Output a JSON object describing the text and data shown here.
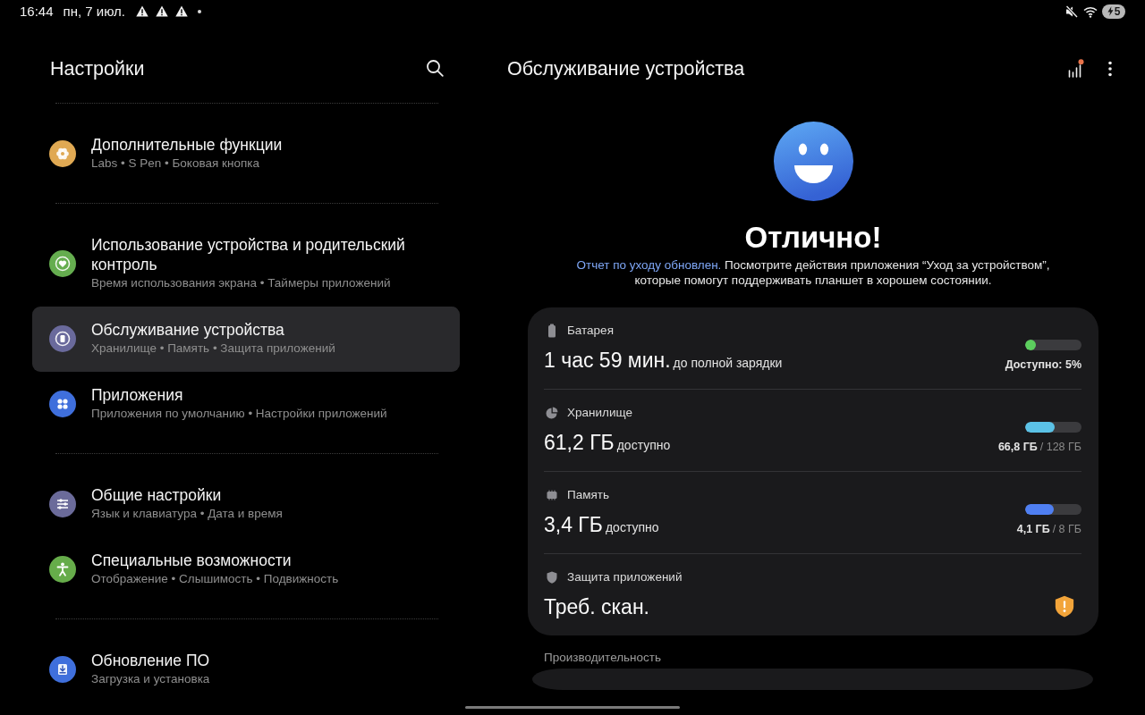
{
  "status_bar": {
    "time": "16:44",
    "date": "пн, 7 июл.",
    "notifications": [
      {
        "kind": "warning"
      },
      {
        "kind": "warning"
      },
      {
        "kind": "warning"
      }
    ],
    "more_notifications": true,
    "muted": true,
    "charging": true,
    "battery": "5"
  },
  "settings": {
    "title": "Настройки",
    "groups": [
      {
        "items": [
          {
            "title": "Дополнительные функции",
            "subtitle": "Labs • S Pen • Боковая кнопка",
            "color": "#e0a953",
            "selected": false
          }
        ]
      },
      {
        "items": [
          {
            "title": "Использование устройства и родительский контроль",
            "subtitle": "Время использования экрана • Таймеры приложений",
            "color": "#65ad4f",
            "selected": false
          },
          {
            "title": "Обслуживание устройства",
            "subtitle": "Хранилище • Память • Защита приложений",
            "color": "#6a6a9c",
            "selected": true
          },
          {
            "title": "Приложения",
            "subtitle": "Приложения по умолчанию • Настройки приложений",
            "color": "#3f6fdc",
            "selected": false
          }
        ]
      },
      {
        "items": [
          {
            "title": "Общие настройки",
            "subtitle": "Язык и клавиатура • Дата и время",
            "color": "#6b6b9a",
            "selected": false
          },
          {
            "title": "Специальные возможности",
            "subtitle": "Отображение • Слышимость • Подвижность",
            "color": "#66ac4a",
            "selected": false
          }
        ]
      },
      {
        "items": [
          {
            "title": "Обновление ПО",
            "subtitle": "Загрузка и установка",
            "color": "#3f6fdc",
            "selected": false
          }
        ]
      }
    ]
  },
  "device_care": {
    "title": "Обслуживание устройства",
    "report_badge": true,
    "status": "Отлично!",
    "report": {
      "link": "Отчет по уходу обновлен.",
      "text": "Посмотрите действия приложения “Уход за устройством”, которые помогут поддерживать планшет в хорошем состоянии."
    },
    "sections": [
      {
        "kind": "meter",
        "label": "Батарея",
        "value": "1 час 59 мин.",
        "unit": "до полной зарядки",
        "level": 0.05,
        "color": "#5ccf5e",
        "reading": "Доступно: 5%"
      },
      {
        "kind": "meter",
        "label": "Хранилище",
        "value": "61,2 ГБ",
        "unit": "доступно",
        "level": 0.52,
        "color": "#5bc2e6",
        "reading": "66,8 ГБ",
        "total": "/ 128 ГБ"
      },
      {
        "kind": "meter",
        "label": "Память",
        "value": "3,4 ГБ",
        "unit": "доступно",
        "level": 0.51,
        "color": "#4f7ff2",
        "reading": "4,1 ГБ",
        "total": "/ 8 ГБ"
      },
      {
        "kind": "alert",
        "label": "Защита приложений",
        "value": "Треб. скан.",
        "alert": true
      }
    ],
    "next_section": "Производительность"
  }
}
